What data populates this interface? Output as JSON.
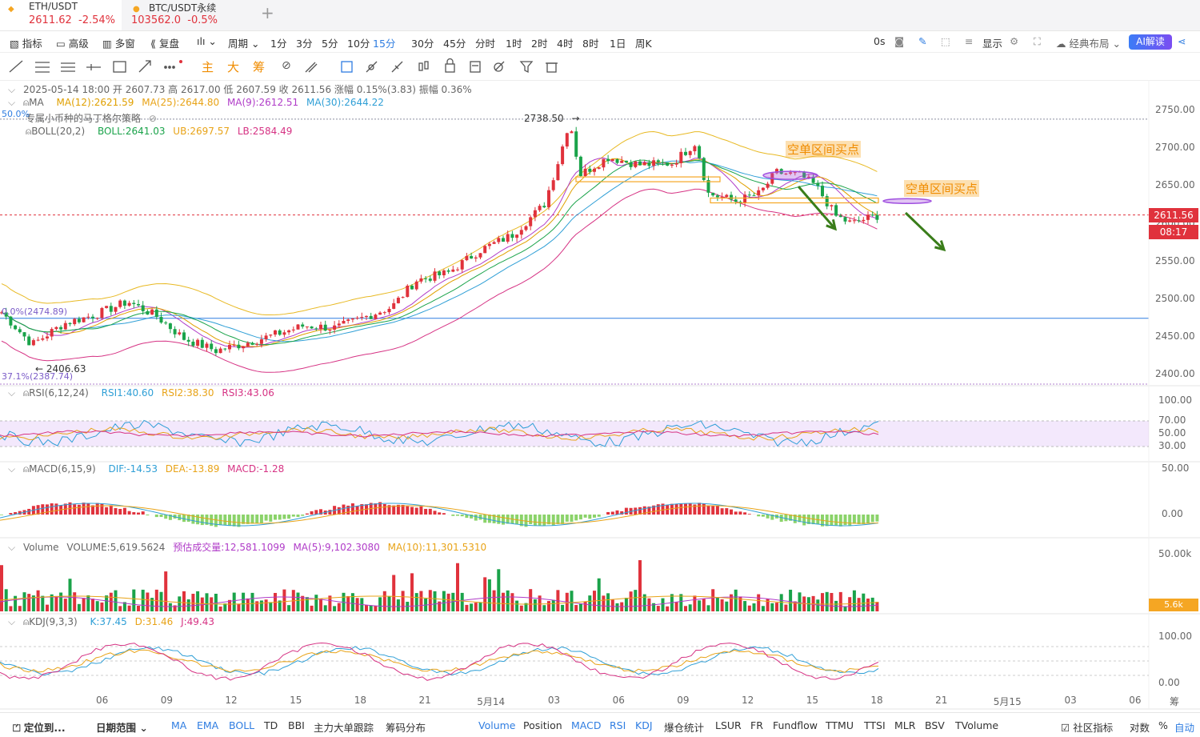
{
  "tabs": [
    {
      "name": "ETH/USDT",
      "price": "2611.62",
      "change": "-2.54%"
    },
    {
      "name": "BTC/USDT永续",
      "price": "103562.0",
      "change": "-0.5%"
    }
  ],
  "toolbar": {
    "left": [
      "指标",
      "高级",
      "多窗",
      "复盘",
      "周期"
    ],
    "periods": [
      "1分",
      "3分",
      "5分",
      "10分",
      "15分",
      "30分",
      "45分",
      "分时",
      "1时",
      "2时",
      "4时",
      "8时",
      "1日",
      "周K"
    ],
    "active_period": "15分",
    "countdown": "0s",
    "display": "显示",
    "layout": "经典布局",
    "ai": "AI解读"
  },
  "drawbar": {
    "texts": [
      "主",
      "大",
      "筹"
    ]
  },
  "legend": {
    "ohlc": "2025-05-14 18:00 开 2607.73 高 2617.00 低 2607.59 收 2611.56 涨幅 0.15%(3.83) 振幅 0.36%",
    "ma_label": "MA",
    "ma12": "MA(12):2621.59",
    "ma25": "MA(25):2644.80",
    "ma9": "MA(9):2612.51",
    "ma30": "MA(30):2644.22",
    "strategy": "专属小币种的马丁格尔策略",
    "boll_label": "BOLL(20,2)",
    "boll": "BOLL:2641.03",
    "ub": "UB:2697.57",
    "lb": "LB:2584.49",
    "rsi_label": "RSI(6,12,24)",
    "rsi1": "RSI1:40.60",
    "rsi2": "RSI2:38.30",
    "rsi3": "RSI3:43.06",
    "macd_label": "MACD(6,15,9)",
    "dif": "DIF:-14.53",
    "dea": "DEA:-13.89",
    "macd": "MACD:-1.28",
    "vol_label": "Volume",
    "vol": "VOLUME:5,619.5624",
    "vol_est": "预估成交量:12,581.1099",
    "vol_ma5": "MA(5):9,102.3080",
    "vol_ma10": "MA(10):11,301.5310",
    "kdj_label": "KDJ(9,3,3)",
    "k": "K:37.45",
    "d": "D:31.46",
    "j": "J:49.43"
  },
  "annotations": {
    "high": "2738.50",
    "low": "2406.63",
    "fib_top": "50.0%",
    "fib_mid": "0.0%(2474.89)",
    "fib_bottom": "37.1%(2387.74)",
    "note1": "空单区间买点",
    "note2": "空单区间买点"
  },
  "price_axis": [
    "2750.00",
    "2700.00",
    "2650.00",
    "2600.00",
    "2550.00",
    "2500.00",
    "2450.00",
    "2400.00"
  ],
  "current_price": "2611.56",
  "countdown_tag": "08:17",
  "rsi_axis": [
    "100.00",
    "70.00",
    "50.00",
    "30.00"
  ],
  "macd_axis": [
    "50.00",
    "0.00"
  ],
  "vol_axis": [
    "50.00k"
  ],
  "vol_tag": "5.6k",
  "kdj_axis": [
    "100.00",
    "0.00"
  ],
  "time_axis": [
    "06",
    "09",
    "12",
    "15",
    "18",
    "21",
    "5月14",
    "03",
    "06",
    "09",
    "12",
    "15",
    "18",
    "21",
    "5月15",
    "03",
    "06"
  ],
  "time_axis_right": "筹",
  "bottombar": {
    "locate": "定位到...",
    "range": "日期范围",
    "indicators": [
      "MA",
      "EMA",
      "BOLL",
      "TD",
      "BBI",
      "主力大单跟踪",
      "筹码分布"
    ],
    "sub_indicators": [
      "Volume",
      "Position",
      "MACD",
      "RSI",
      "KDJ",
      "爆仓统计",
      "LSUR",
      "FR",
      "Fundflow",
      "TTMU",
      "TTSI",
      "MLR",
      "BSV",
      "TVolume"
    ],
    "community": "社区指标",
    "log": "对数",
    "pct": "%",
    "auto": "自动"
  },
  "colors": {
    "up": "#e0323c",
    "down": "#1aa34a",
    "accent": "#2f7de1",
    "ma12": "#e0a000",
    "ma25": "#e8a317",
    "ma9": "#b03cc8",
    "ma30": "#2f9fd6"
  }
}
